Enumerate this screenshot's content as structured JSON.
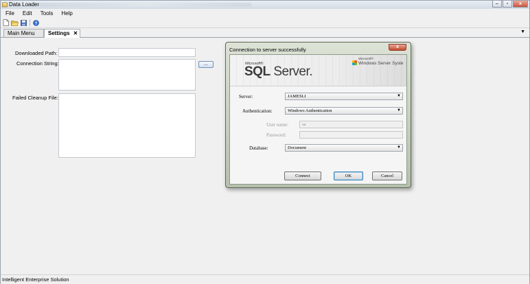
{
  "window": {
    "title": "Data Loader"
  },
  "menu": [
    "File",
    "Edit",
    "Tools",
    "Help"
  ],
  "toolbar": {
    "icons": [
      "new-icon",
      "open-icon",
      "save-icon",
      "help-icon"
    ]
  },
  "tabs": [
    {
      "label": "Main Menu",
      "active": false
    },
    {
      "label": "Settings",
      "active": true,
      "close": "✕"
    }
  ],
  "tabs_dropdown": "▼",
  "form": {
    "downloaded_path_label": "Downloaded Path:",
    "downloaded_path_value": "",
    "connection_string_label": "Connection String:",
    "connection_string_value": "",
    "browse_label": "...",
    "failed_cleanup_label": "Failed Cleanup File:",
    "failed_cleanup_value": ""
  },
  "status": {
    "text": "Intelligent Enterprise Solution"
  },
  "dialog": {
    "title": "Connection to server successfully",
    "close_label": "x",
    "banner": {
      "microsoft_small": "Microsoft®",
      "sql_prefix": "SQL",
      "sql_suffix": " Server.",
      "windows_server_microsoft": "Microsoft®",
      "windows_server": "Windows Server Syste"
    },
    "server_label": "Server:",
    "server_value": "JAMESLI",
    "auth_label": "Authentication:",
    "auth_value": "Windows Authentication",
    "username_label": "User name:",
    "username_value": "sa",
    "password_label": "Password:",
    "password_value": "",
    "database_label": "Database:",
    "database_value": "Document",
    "connect_label": "Connect",
    "ok_label": "OK",
    "cancel_label": "Cancel"
  },
  "colors": {
    "dialog_frame": "#b6c0ad",
    "close_red": "#c24a30",
    "accent_blue": "#3c7fb1"
  }
}
